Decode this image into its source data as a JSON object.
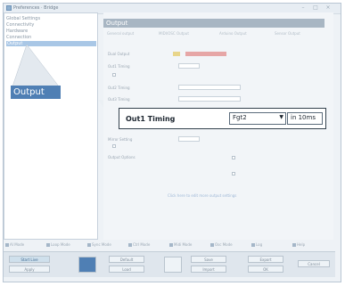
{
  "window": {
    "title": "Preferences · Bridge"
  },
  "sidebar": {
    "items": [
      {
        "label": "Global Settings",
        "selected": false
      },
      {
        "label": "Connectivity",
        "selected": false
      },
      {
        "label": "Hardware",
        "selected": false
      },
      {
        "label": "Connection",
        "selected": false
      },
      {
        "label": "Output",
        "selected": true
      }
    ]
  },
  "main": {
    "section_title": "Output",
    "tabs": [
      "General output",
      "MIDI/OSC Output",
      "Arduino Output",
      "Sensor Output"
    ],
    "rows": [
      {
        "label": "Dual Output"
      },
      {
        "label": "Out1 Timing"
      },
      {
        "label": "Out2 Timing"
      },
      {
        "label": "Out3 Timing"
      },
      {
        "label": "Mirror Setting"
      },
      {
        "label": "Output Options"
      }
    ],
    "link": "Click here to edit more output settings"
  },
  "magnifier": {
    "label": "Out1 Timing",
    "select_value": "Fgt2",
    "unit_value": "in 10ms"
  },
  "callout": {
    "label": "Output"
  },
  "bottom_strip": [
    "AI Mode",
    "Loop Mode",
    "Sync Mode",
    "Ctrl Mode",
    "Midi Mode",
    "Osc Mode",
    "Log",
    "Help"
  ],
  "footer": {
    "buttons": [
      "Apply",
      "Default",
      "Load",
      "Save",
      "Import",
      "Export",
      "OK",
      "Cancel"
    ],
    "start_label": "Start Live"
  },
  "colors": {
    "accent": "#4f7fb4",
    "header": "#a8b6c3",
    "selected": "#a9c7e6"
  }
}
